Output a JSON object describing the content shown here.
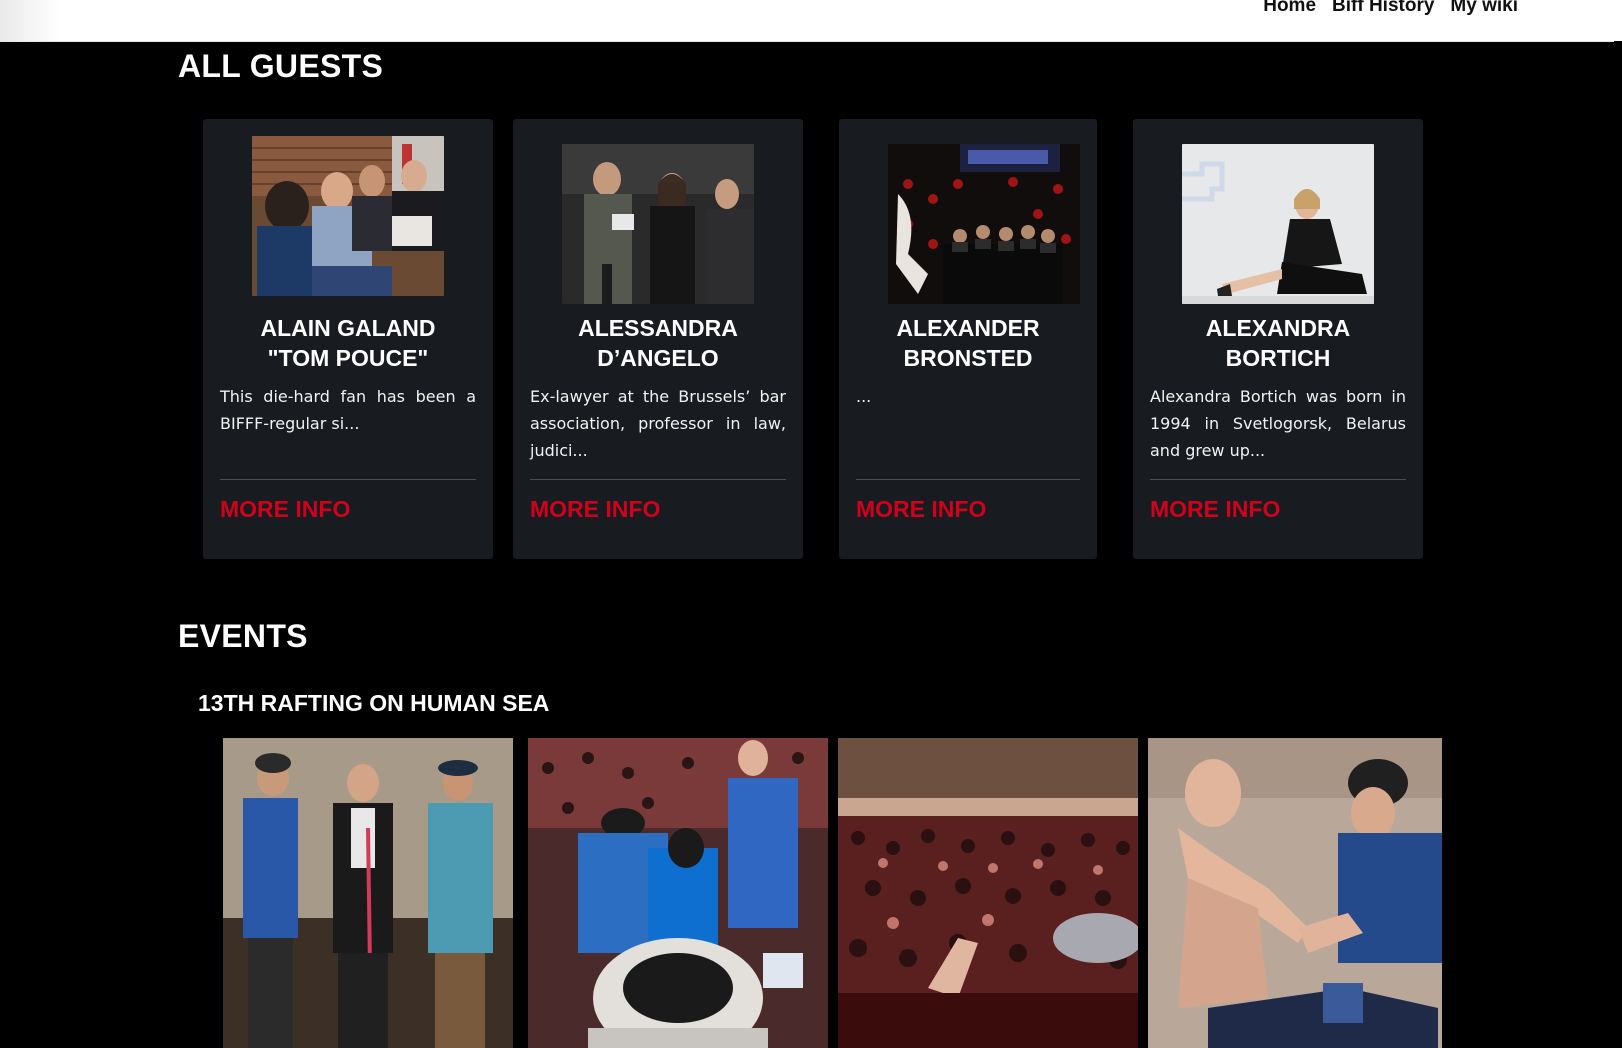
{
  "nav": {
    "items": [
      "Home",
      "Biff History",
      "My wiki"
    ]
  },
  "guests": {
    "title": "ALL GUESTS",
    "more_label": "MORE INFO",
    "cards": [
      {
        "name_line1": "ALAIN GALAND",
        "name_line2": "\"TOM POUCE\"",
        "desc": "This die-hard fan has been a BIFFF-regular si..."
      },
      {
        "name_line1": "ALESSANDRA",
        "name_line2": "D’ANGELO",
        "desc": "Ex-lawyer at the Brussels’ bar association, professor in law, judici..."
      },
      {
        "name_line1": "ALEXANDER",
        "name_line2": "BRONSTED",
        "desc": "..."
      },
      {
        "name_line1": "ALEXANDRA",
        "name_line2": "BORTICH",
        "desc": "Alexandra Bortich was born in 1994 in Svetlogorsk, Belarus and grew up..."
      }
    ]
  },
  "events": {
    "title": "EVENTS",
    "event_name": "13TH RAFTING ON HUMAN SEA"
  },
  "colors": {
    "accent": "#d0021b",
    "card_bg": "#181b1f",
    "page_bg": "#000000"
  }
}
